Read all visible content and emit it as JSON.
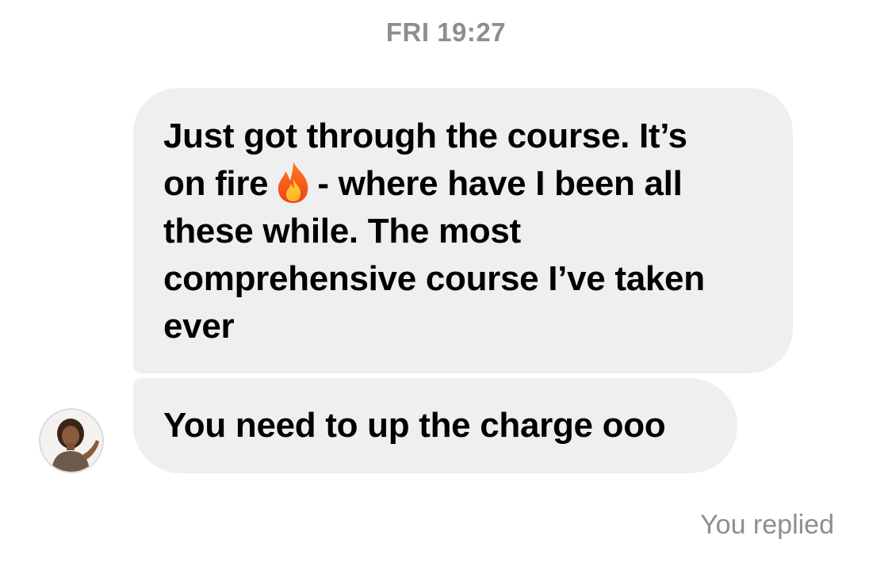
{
  "thread": {
    "timestamp": "FRI 19:27",
    "messages": [
      {
        "lines": [
          "Just got through the course. It’s",
          "on fire",
          "- where have I been all",
          "these while. The most",
          "comprehensive course I’ve taken",
          "ever"
        ],
        "inline_icon": "fire-icon"
      },
      {
        "text": "You need to up the charge ooo"
      }
    ],
    "sender_avatar": "avatar",
    "status_text": "You replied"
  },
  "colors": {
    "bubble_bg": "#efefef",
    "meta_text": "#8e8e8e",
    "message_text": "#000000"
  }
}
